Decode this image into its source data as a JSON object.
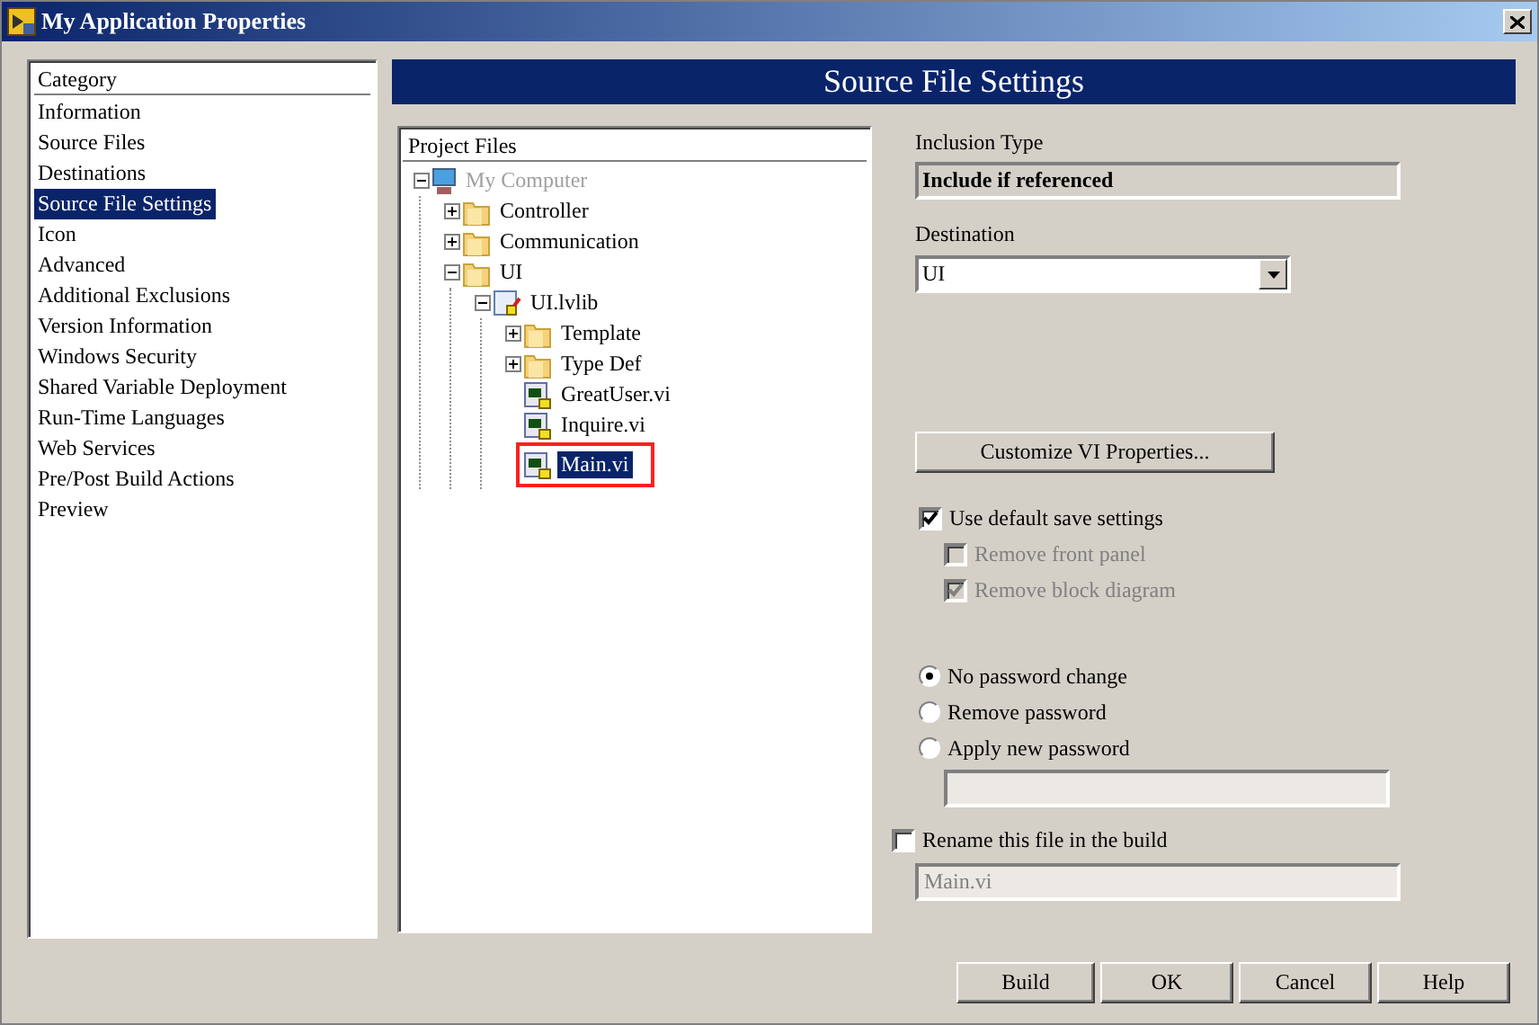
{
  "window": {
    "title": "My Application Properties"
  },
  "category": {
    "header": "Category",
    "items": [
      {
        "label": "Information",
        "selected": false
      },
      {
        "label": "Source Files",
        "selected": false
      },
      {
        "label": "Destinations",
        "selected": false
      },
      {
        "label": "Source File Settings",
        "selected": true
      },
      {
        "label": "Icon",
        "selected": false
      },
      {
        "label": "Advanced",
        "selected": false
      },
      {
        "label": "Additional Exclusions",
        "selected": false
      },
      {
        "label": "Version Information",
        "selected": false
      },
      {
        "label": "Windows Security",
        "selected": false
      },
      {
        "label": "Shared Variable Deployment",
        "selected": false
      },
      {
        "label": "Run-Time Languages",
        "selected": false
      },
      {
        "label": "Web Services",
        "selected": false
      },
      {
        "label": "Pre/Post Build Actions",
        "selected": false
      },
      {
        "label": "Preview",
        "selected": false
      }
    ]
  },
  "section_title": "Source File Settings",
  "project_files": {
    "header": "Project Files",
    "tree": [
      {
        "label": "My Computer",
        "kind": "computer",
        "expanded": true,
        "dimmed": true,
        "selected": false,
        "highlighted": false,
        "children": [
          {
            "label": "Controller",
            "kind": "folder",
            "expanded": false,
            "dimmed": false,
            "selected": false,
            "highlighted": false
          },
          {
            "label": "Communication",
            "kind": "folder",
            "expanded": false,
            "dimmed": false,
            "selected": false,
            "highlighted": false
          },
          {
            "label": "UI",
            "kind": "folder",
            "expanded": true,
            "dimmed": false,
            "selected": false,
            "highlighted": false,
            "children": [
              {
                "label": "UI.lvlib",
                "kind": "library",
                "expanded": true,
                "dimmed": false,
                "selected": false,
                "highlighted": false,
                "children": [
                  {
                    "label": "Template",
                    "kind": "folder",
                    "expanded": false,
                    "dimmed": false,
                    "selected": false,
                    "highlighted": false
                  },
                  {
                    "label": "Type Def",
                    "kind": "folder",
                    "expanded": false,
                    "dimmed": false,
                    "selected": false,
                    "highlighted": false
                  },
                  {
                    "label": "GreatUser.vi",
                    "kind": "vi",
                    "dimmed": false,
                    "selected": false,
                    "highlighted": false
                  },
                  {
                    "label": "Inquire.vi",
                    "kind": "vi",
                    "dimmed": false,
                    "selected": false,
                    "highlighted": false
                  },
                  {
                    "label": "Main.vi",
                    "kind": "vi",
                    "dimmed": false,
                    "selected": true,
                    "highlighted": true
                  }
                ]
              }
            ]
          }
        ]
      }
    ]
  },
  "inclusion_type": {
    "label": "Inclusion Type",
    "value": "Include if referenced"
  },
  "destination": {
    "label": "Destination",
    "value": "UI"
  },
  "customize_button": "Customize VI Properties...",
  "save_options": [
    {
      "label": "Use default save settings",
      "kind": "main",
      "checked": true,
      "disabled": false
    },
    {
      "label": "Remove front panel",
      "kind": "sub",
      "checked": false,
      "disabled": true
    },
    {
      "label": "Remove block diagram",
      "kind": "sub",
      "checked": true,
      "disabled": true
    }
  ],
  "password_options": [
    {
      "label": "No password change",
      "selected": true
    },
    {
      "label": "Remove password",
      "selected": false
    },
    {
      "label": "Apply new password",
      "selected": false
    }
  ],
  "rename": {
    "label": "Rename this file in the build",
    "checked": false,
    "value": "Main.vi",
    "disabled": true
  },
  "buttons": [
    "Build",
    "OK",
    "Cancel",
    "Help"
  ]
}
